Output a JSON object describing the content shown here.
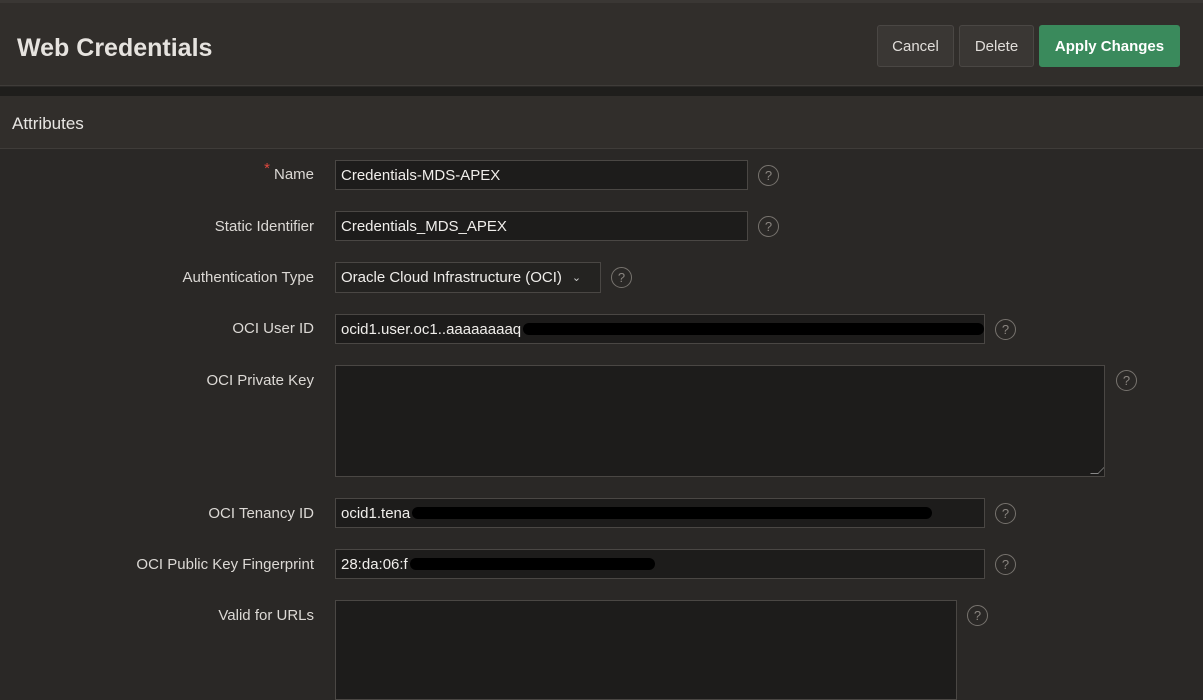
{
  "header": {
    "title": "Web Credentials",
    "cancel": "Cancel",
    "delete": "Delete",
    "apply": "Apply Changes"
  },
  "region": {
    "title": "Attributes"
  },
  "form": {
    "name": {
      "label": "Name",
      "required": "*",
      "value": "Credentials-MDS-APEX"
    },
    "static_id": {
      "label": "Static Identifier",
      "value": "Credentials_MDS_APEX"
    },
    "auth_type": {
      "label": "Authentication Type",
      "value": "Oracle Cloud Infrastructure (OCI)"
    },
    "user_id": {
      "label": "OCI User ID",
      "value": "ocid1.user.oc1..aaaaaaaaq"
    },
    "private_key": {
      "label": "OCI Private Key",
      "value": ""
    },
    "tenancy_id": {
      "label": "OCI Tenancy ID",
      "value": "ocid1.tena"
    },
    "fingerprint": {
      "label": "OCI Public Key Fingerprint",
      "value": "28:da:06:f"
    },
    "valid_urls": {
      "label": "Valid for URLs",
      "value": ""
    },
    "help": "?"
  },
  "colors": {
    "primary": "#3a8a5c",
    "required": "#e0483e"
  }
}
